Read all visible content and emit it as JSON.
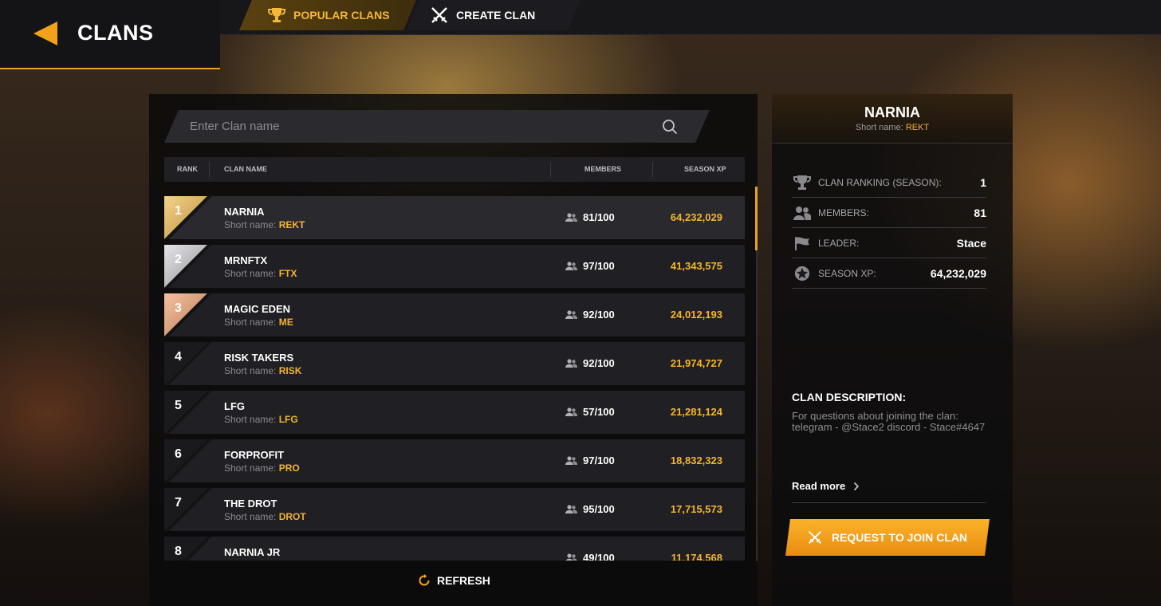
{
  "header": {
    "title": "CLANS"
  },
  "tabs": [
    {
      "label": "POPULAR CLANS",
      "icon": "trophy-icon",
      "active": true
    },
    {
      "label": "CREATE CLAN",
      "icon": "crossed-swords-icon",
      "active": false
    }
  ],
  "search": {
    "placeholder": "Enter Clan name",
    "value": ""
  },
  "table": {
    "headers": {
      "rank": "RANK",
      "clan_name": "CLAN NAME",
      "members": "MEMBERS",
      "season_xp": "SEASON XP"
    },
    "short_prefix": "Short name:",
    "rows": [
      {
        "rank": "1",
        "name": "NARNIA",
        "short": "REKT",
        "members": "81/100",
        "xp": "64,232,029",
        "tier": "gold"
      },
      {
        "rank": "2",
        "name": "MRNFTX",
        "short": "FTX",
        "members": "97/100",
        "xp": "41,343,575",
        "tier": "silver"
      },
      {
        "rank": "3",
        "name": "MAGIC EDEN",
        "short": "ME",
        "members": "92/100",
        "xp": "24,012,193",
        "tier": "bronze"
      },
      {
        "rank": "4",
        "name": "RISK TAKERS",
        "short": "RISK",
        "members": "92/100",
        "xp": "21,974,727",
        "tier": "plain"
      },
      {
        "rank": "5",
        "name": "LFG",
        "short": "LFG",
        "members": "57/100",
        "xp": "21,281,124",
        "tier": "plain"
      },
      {
        "rank": "6",
        "name": "FORPROFIT",
        "short": "PRO",
        "members": "97/100",
        "xp": "18,832,323",
        "tier": "plain"
      },
      {
        "rank": "7",
        "name": "THE DROT",
        "short": "DROT",
        "members": "95/100",
        "xp": "17,715,573",
        "tier": "plain"
      },
      {
        "rank": "8",
        "name": "NARNIA JR",
        "short": "",
        "members": "49/100",
        "xp": "11,174,568",
        "tier": "plain"
      }
    ]
  },
  "refresh_label": "REFRESH",
  "details": {
    "name": "NARNIA",
    "short_prefix": "Short name:",
    "short": "REKT",
    "stats": [
      {
        "icon": "trophy-icon",
        "label": "CLAN RANKING (SEASON):",
        "value": "1"
      },
      {
        "icon": "members-icon",
        "label": "MEMBERS:",
        "value": "81"
      },
      {
        "icon": "flag-icon",
        "label": "LEADER:",
        "value": "Stace"
      },
      {
        "icon": "star-badge-icon",
        "label": "SEASON XP:",
        "value": "64,232,029"
      }
    ],
    "description_title": "CLAN DESCRIPTION:",
    "description": "For questions about joining the clan: telegram - @Stace2 discord - Stace#4647",
    "read_more": "Read more",
    "join_label": "REQUEST TO JOIN CLAN"
  },
  "colors": {
    "accent": "#f5b52c",
    "gold": "#e0b45a",
    "silver": "#b9b9bd",
    "bronze": "#e2a07a"
  }
}
